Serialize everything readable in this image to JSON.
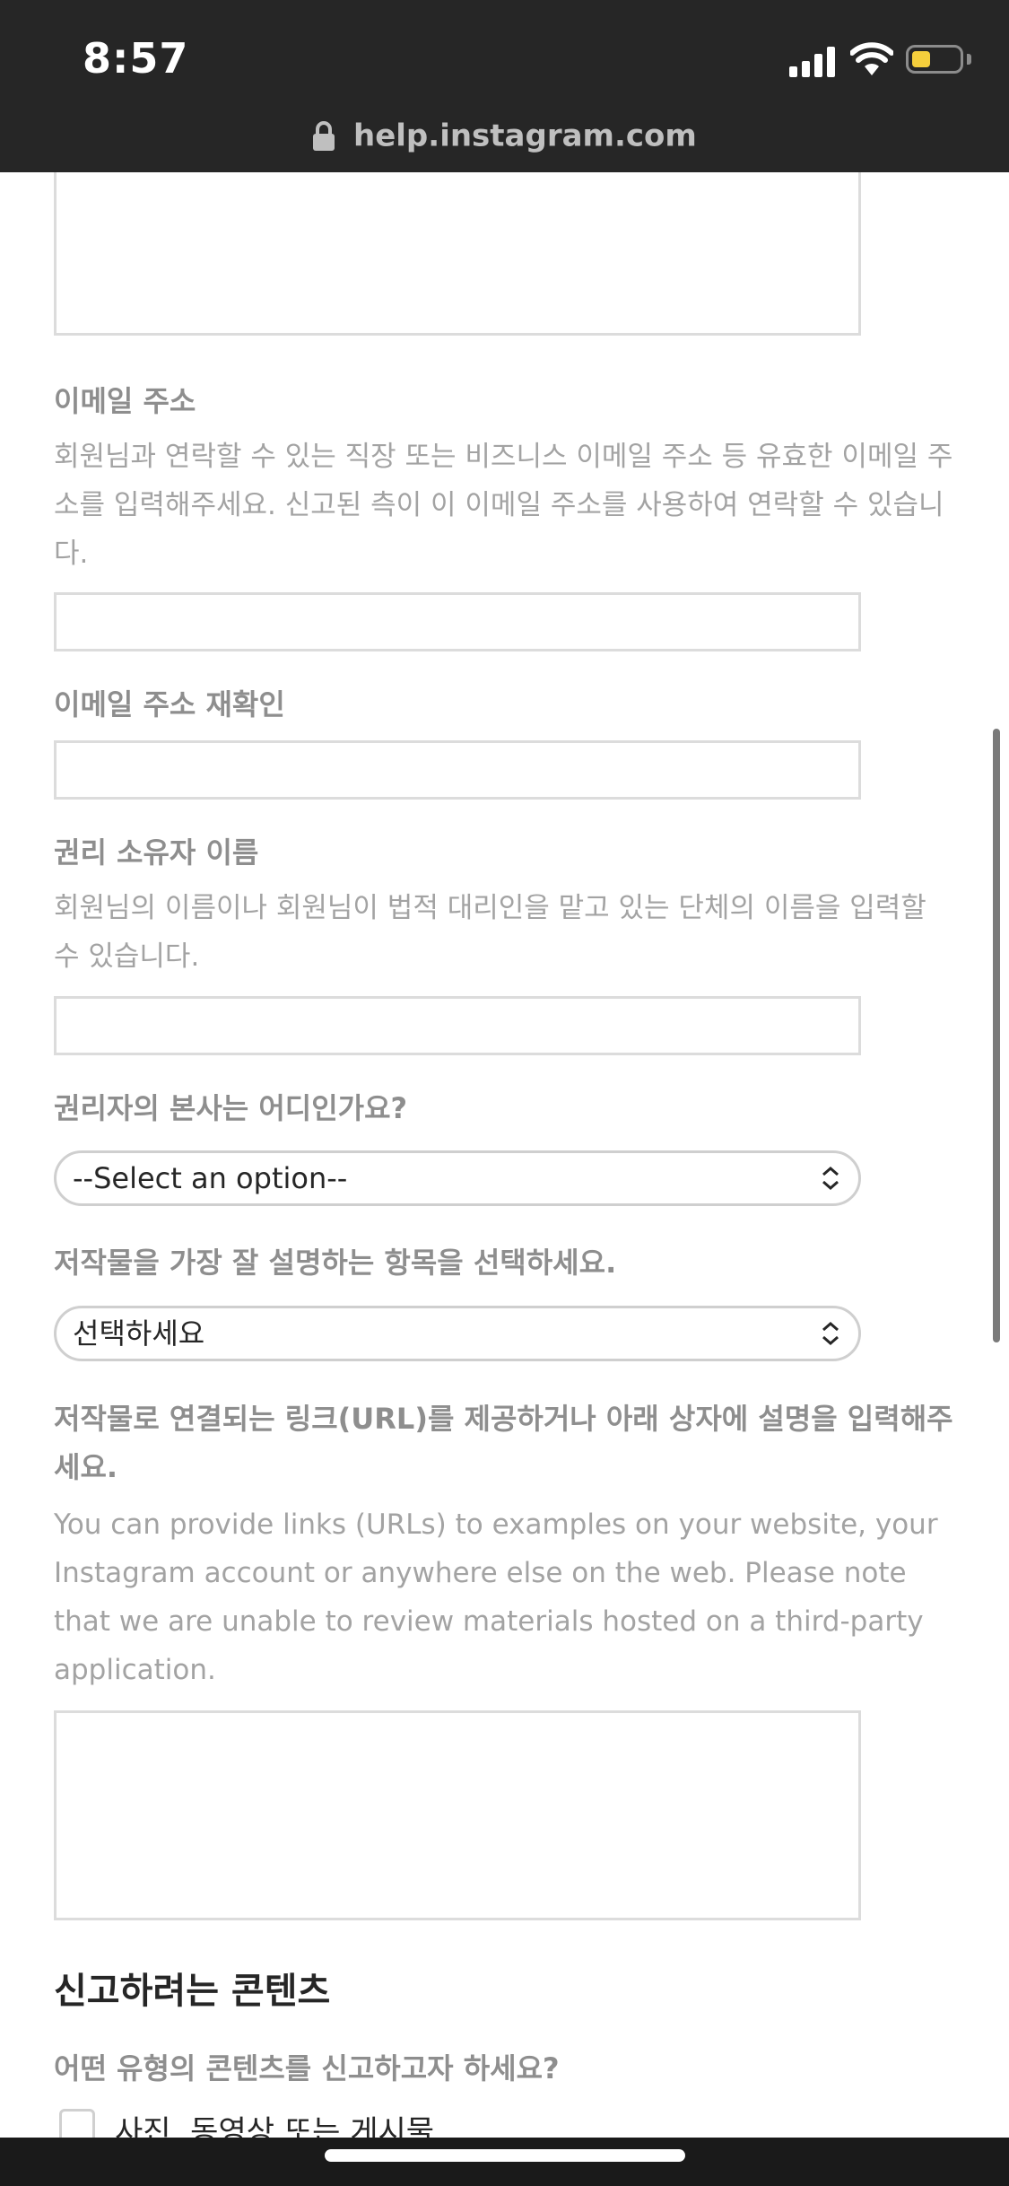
{
  "status_bar": {
    "time": "8:57"
  },
  "browser": {
    "url": "help.instagram.com"
  },
  "form": {
    "email": {
      "label": "이메일 주소",
      "description": "회원님과 연락할 수 있는 직장 또는 비즈니스 이메일 주소 등 유효한 이메일 주소를 입력해주세요. 신고된 측이 이 이메일 주소를 사용하여 연락할 수 있습니다.",
      "value": ""
    },
    "email_confirm": {
      "label": "이메일 주소 재확인",
      "value": ""
    },
    "owner_name": {
      "label": "권리 소유자 이름",
      "description": "회원님의 이름이나 회원님이 법적 대리인을 맡고 있는 단체의 이름을 입력할 수 있습니다.",
      "value": ""
    },
    "headquarters": {
      "label": "권리자의 본사는 어디인가요?",
      "selected": "--Select an option--"
    },
    "work_type": {
      "label": "저작물을 가장 잘 설명하는 항목을 선택하세요.",
      "selected": "선택하세요"
    },
    "work_links": {
      "label": "저작물로 연결되는 링크(URL)를 제공하거나 아래 상자에 설명을 입력해주세요.",
      "description": "You can provide links (URLs) to examples on your website, your Instagram account or anywhere else on the web. Please note that we are unable to review materials hosted on a third-party application.",
      "value": ""
    }
  },
  "report_section": {
    "title": "신고하려는 콘텐츠",
    "question": "어떤 유형의 콘텐츠를 신고하고자 하세요?",
    "options": [
      {
        "label": "사진, 동영상 또는 게시물",
        "checked": false
      }
    ]
  }
}
